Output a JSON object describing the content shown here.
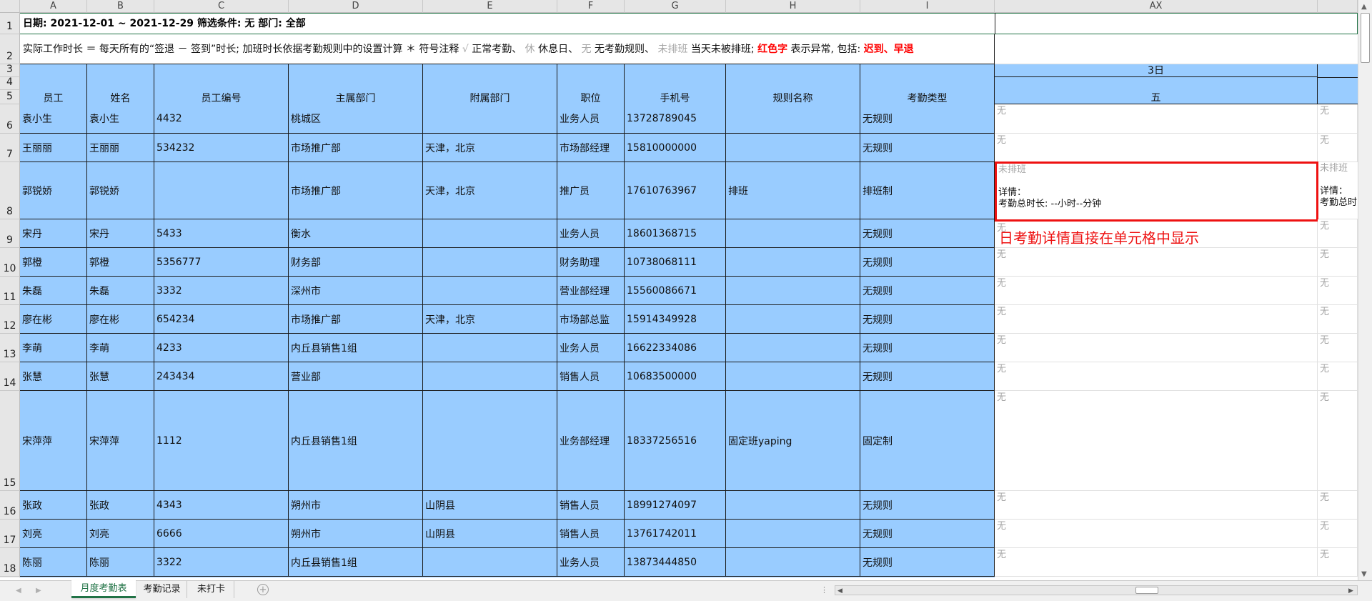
{
  "columns": {
    "letters": [
      "A",
      "B",
      "C",
      "D",
      "E",
      "F",
      "G",
      "H",
      "I",
      "AX"
    ],
    "corner": ""
  },
  "row_numbers": [
    "1",
    "2",
    "3",
    "4",
    "5",
    "6",
    "7",
    "8",
    "9",
    "10",
    "11",
    "12",
    "13",
    "14",
    "15",
    "16",
    "17",
    "18"
  ],
  "title_row": "日期: 2021-12-01 ~ 2021-12-29  筛选条件: 无  部门: 全部",
  "legend_row": {
    "text1": "实际工作时长 ＝ 每天所有的“签退 － 签到”时长; 加班时长依据考勤规则中的设置计算  ＊ 符号注释",
    "check": "√",
    "normal": "正常考勤、",
    "rest_sym": "休",
    "rest": "休息日、",
    "none_sym": "无",
    "none": "无考勤规则、",
    "unsched_sym": "未排班",
    "unsched": "当天未被排班;",
    "red_word": "红色字",
    "red_desc": "表示异常, 包括:",
    "late": "迟到",
    "sep": "、",
    "early": "早退"
  },
  "headers": [
    "员工",
    "姓名",
    "员工编号",
    "主属部门",
    "附属部门",
    "职位",
    "手机号",
    "规则名称",
    "考勤类型"
  ],
  "day_header": {
    "date": "3日",
    "weekday": "五"
  },
  "employees": [
    {
      "emp": "袁小生",
      "name": "袁小生",
      "id": "4432",
      "dept": "桃城区",
      "sub": "",
      "pos": "业务人员",
      "phone": "13728789045",
      "rule": "",
      "type": "无规则",
      "day": "无",
      "next": "无"
    },
    {
      "emp": "王丽丽",
      "name": "王丽丽",
      "id": "534232",
      "dept": "市场推广部",
      "sub": "天津，北京",
      "pos": "市场部经理",
      "phone": "15810000000",
      "rule": "",
      "type": "无规则",
      "day": "无",
      "next": "无"
    },
    {
      "emp": "郭锐娇",
      "name": "郭锐娇",
      "id": "",
      "dept": "市场推广部",
      "sub": "天津，北京",
      "pos": "推广员",
      "phone": "17610763967",
      "rule": "排班",
      "type": "排班制",
      "day": "未排班",
      "next": "未排班"
    },
    {
      "emp": "宋丹",
      "name": "宋丹",
      "id": "5433",
      "dept": "衡水",
      "sub": "",
      "pos": "业务人员",
      "phone": "18601368715",
      "rule": "",
      "type": "无规则",
      "day": "无",
      "next": "无"
    },
    {
      "emp": "郭橙",
      "name": "郭橙",
      "id": "5356777",
      "dept": "财务部",
      "sub": "",
      "pos": "财务助理",
      "phone": "10738068111",
      "rule": "",
      "type": "无规则",
      "day": "无",
      "next": "无"
    },
    {
      "emp": "朱磊",
      "name": "朱磊",
      "id": "3332",
      "dept": "深州市",
      "sub": "",
      "pos": "营业部经理",
      "phone": "15560086671",
      "rule": "",
      "type": "无规则",
      "day": "无",
      "next": "无"
    },
    {
      "emp": "廖在彬",
      "name": "廖在彬",
      "id": "654234",
      "dept": "市场推广部",
      "sub": "天津，北京",
      "pos": "市场部总监",
      "phone": "15914349928",
      "rule": "",
      "type": "无规则",
      "day": "无",
      "next": "无"
    },
    {
      "emp": "李萌",
      "name": "李萌",
      "id": "4233",
      "dept": "内丘县销售1组",
      "sub": "",
      "pos": "业务人员",
      "phone": "16622334086",
      "rule": "",
      "type": "无规则",
      "day": "无",
      "next": "无"
    },
    {
      "emp": "张慧",
      "name": "张慧",
      "id": "243434",
      "dept": "营业部",
      "sub": "",
      "pos": "销售人员",
      "phone": "10683500000",
      "rule": "",
      "type": "无规则",
      "day": "无",
      "next": "无"
    },
    {
      "emp": "宋萍萍",
      "name": "宋萍萍",
      "id": "1112",
      "dept": "内丘县销售1组",
      "sub": "",
      "pos": "业务部经理",
      "phone": "18337256516",
      "rule": "固定班yaping",
      "type": "固定制",
      "day": "无",
      "next": "无"
    },
    {
      "emp": "张政",
      "name": "张政",
      "id": "4343",
      "dept": "朔州市",
      "sub": "山阴县",
      "pos": "销售人员",
      "phone": "18991274097",
      "rule": "",
      "type": "无规则",
      "day": "无",
      "next": "无"
    },
    {
      "emp": "刘亮",
      "name": "刘亮",
      "id": "6666",
      "dept": "朔州市",
      "sub": "山阴县",
      "pos": "销售人员",
      "phone": "13761742011",
      "rule": "",
      "type": "无规则",
      "day": "无",
      "next": "无"
    },
    {
      "emp": "陈丽",
      "name": "陈丽",
      "id": "3322",
      "dept": "内丘县销售1组",
      "sub": "",
      "pos": "业务人员",
      "phone": "13873444850",
      "rule": "",
      "type": "无规则",
      "day": "无",
      "next": "无"
    }
  ],
  "detail": {
    "label": "详情：",
    "total": "考勤总时长: --小时--分钟",
    "next_label": "详情：",
    "next_total": "考勤总时"
  },
  "annotation": "日考勤详情直接在单元格中显示",
  "sheets": {
    "active": "月度考勤表",
    "tab2": "考勤记录",
    "tab3": "未打卡"
  },
  "colors": {
    "header_fill": "#99ccff",
    "accent": "#ff0000",
    "tab_active": "#217346"
  }
}
